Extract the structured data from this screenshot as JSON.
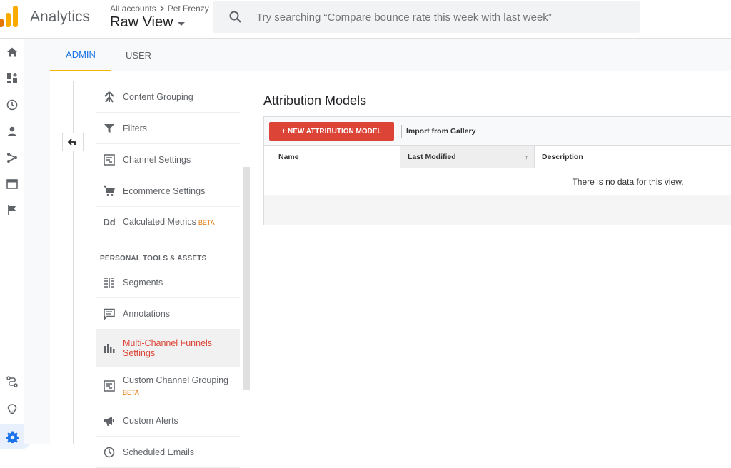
{
  "header": {
    "app_name": "Analytics",
    "breadcrumb": [
      "All accounts",
      "Pet Frenzy"
    ],
    "view_name": "Raw View",
    "search_placeholder": "Try searching “Compare bounce rate this week with last week”"
  },
  "rail": {
    "icons": [
      "home-icon",
      "customization-icon",
      "realtime-icon",
      "audience-icon",
      "acquisition-icon",
      "behavior-icon",
      "conversions-icon",
      "attribution-icon",
      "discover-icon",
      "admin-gear-icon"
    ]
  },
  "tabs": [
    {
      "label": "ADMIN",
      "active": true
    },
    {
      "label": "USER",
      "active": false
    }
  ],
  "menu": {
    "items_top": [
      {
        "label": "Content Grouping",
        "icon": "content-grouping-icon"
      },
      {
        "label": "Filters",
        "icon": "filter-icon"
      },
      {
        "label": "Channel Settings",
        "icon": "channel-settings-icon"
      },
      {
        "label": "Ecommerce Settings",
        "icon": "cart-icon"
      },
      {
        "label": "Calculated Metrics",
        "badge": "BETA",
        "icon": "dd-icon"
      }
    ],
    "section_heading": "PERSONAL TOOLS & ASSETS",
    "items_bottom": [
      {
        "label": "Segments",
        "icon": "segments-icon"
      },
      {
        "label": "Annotations",
        "icon": "annotations-icon"
      },
      {
        "label": "Multi-Channel Funnels Settings",
        "icon": "bar-chart-icon",
        "active": true
      },
      {
        "label": "Custom Channel Grouping",
        "badge": "BETA",
        "icon": "channel-grouping-icon"
      },
      {
        "label": "Custom Alerts",
        "icon": "megaphone-icon"
      },
      {
        "label": "Scheduled Emails",
        "icon": "clock-icon"
      }
    ]
  },
  "main": {
    "title": "Attribution Models",
    "new_button": "+ NEW ATTRIBUTION MODEL",
    "import_button": "Import from Gallery",
    "columns": [
      "Name",
      "Last Modified",
      "Description"
    ],
    "sort_indicator": "↑",
    "empty_message": "There is no data for this view."
  },
  "colors": {
    "accent_blue": "#1a73e8",
    "tab_underline": "#f4b400",
    "primary_red": "#db4437",
    "beta_orange": "#e37400"
  }
}
